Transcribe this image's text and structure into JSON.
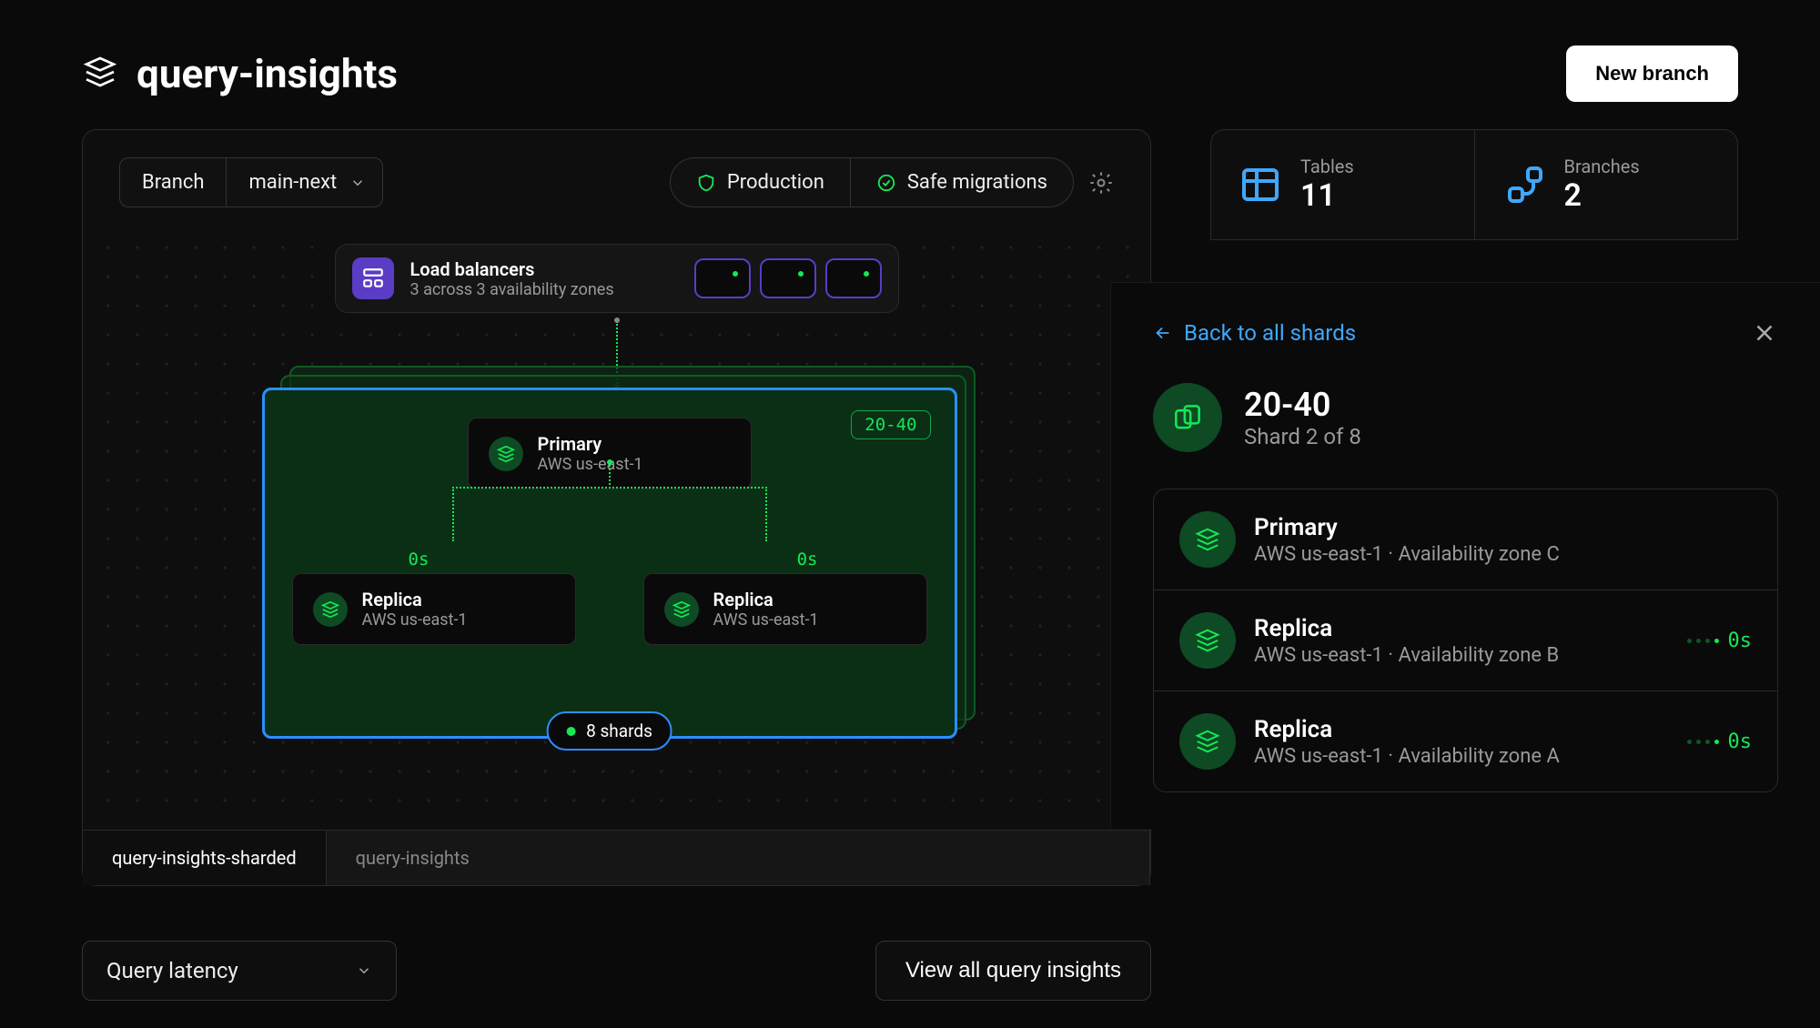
{
  "header": {
    "title": "query-insights",
    "new_branch_label": "New branch"
  },
  "toolbar": {
    "branch_label": "Branch",
    "branch_value": "main-next",
    "production_label": "Production",
    "safe_migrations_label": "Safe migrations"
  },
  "load_balancers": {
    "title": "Load balancers",
    "subtitle": "3 across 3 availability zones"
  },
  "shard": {
    "tag": "20-40",
    "primary": {
      "title": "Primary",
      "sub": "AWS us-east-1"
    },
    "replica_a": {
      "title": "Replica",
      "sub": "AWS us-east-1",
      "latency": "0s"
    },
    "replica_b": {
      "title": "Replica",
      "sub": "AWS us-east-1",
      "latency": "0s"
    },
    "count_label": "8 shards"
  },
  "tabs": {
    "active": "query-insights-sharded",
    "inactive": "query-insights"
  },
  "bottom": {
    "query_latency_label": "Query latency",
    "view_all_label": "View all query insights"
  },
  "stats": {
    "tables_label": "Tables",
    "tables_value": "11",
    "branches_label": "Branches",
    "branches_value": "2"
  },
  "side_panel": {
    "back_label": "Back to all shards",
    "shard_title": "20-40",
    "shard_sub": "Shard 2 of 8",
    "items": [
      {
        "title": "Primary",
        "sub": "AWS us-east-1 · Availability zone C",
        "latency": ""
      },
      {
        "title": "Replica",
        "sub": "AWS us-east-1 · Availability zone B",
        "latency": "0s"
      },
      {
        "title": "Replica",
        "sub": "AWS us-east-1 · Availability zone A",
        "latency": "0s"
      }
    ]
  },
  "colors": {
    "accent_green": "#14e956",
    "accent_blue": "#2a8fff",
    "accent_purple": "#5b3cc4"
  }
}
